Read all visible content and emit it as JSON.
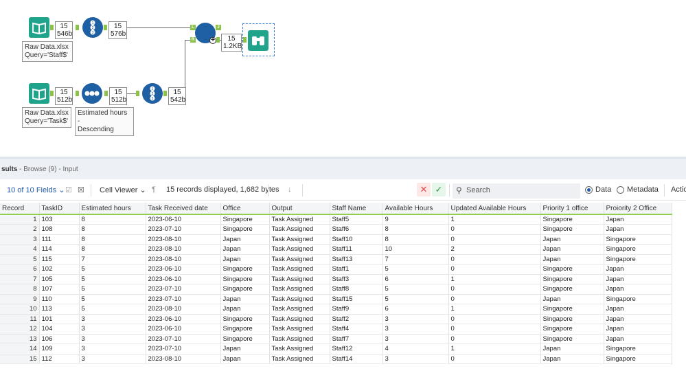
{
  "workflow": {
    "top_input_badge": {
      "count": "15",
      "size": "546b"
    },
    "top_select_badge": {
      "count": "15",
      "size": "576b"
    },
    "join_badge": {
      "count": "15",
      "size": "1.2KB"
    },
    "bottom_input_badge": {
      "count": "15",
      "size": "512b"
    },
    "sort_badge": {
      "count": "15",
      "size": "512b"
    },
    "bottom_select_badge": {
      "count": "15",
      "size": "542b"
    },
    "annot_top": {
      "line1": "Raw Data.xlsx",
      "line2": "Query='Staff$'"
    },
    "annot_bottom": {
      "line1": "Raw Data.xlsx",
      "line2": "Query='Task$'"
    },
    "annot_sort": {
      "line1": "Estimated hours -",
      "line2": "Descending"
    },
    "select_icon": "1 2 3",
    "sort_icon": "•••",
    "join_anchors": {
      "l": "L",
      "r": "R",
      "j": "J"
    }
  },
  "results": {
    "title": "sults",
    "subtitle": " - Browse (9) - Input",
    "fields_label": "10 of 10 Fields",
    "cell_viewer": "Cell Viewer",
    "records_info": "15 records displayed, 1,682 bytes",
    "search_placeholder": "Search",
    "data_label": "Data",
    "metadata_label": "Metadata",
    "actions_label": "Actio",
    "columns": [
      "Record",
      "TaskID",
      "Estimated hours",
      "Task Received date",
      "Office",
      "Output",
      "Staff Name",
      "Available Hours",
      "Updated Available Hours",
      "Priority 1 office",
      "Proiority 2 Office"
    ],
    "rows": [
      [
        "1",
        "103",
        "8",
        "2023-06-10",
        "Singapore",
        "Task Assigned",
        "Staff5",
        "9",
        "1",
        "Singapore",
        "Japan"
      ],
      [
        "2",
        "108",
        "8",
        "2023-07-10",
        "Singapore",
        "Task Assigned",
        "Staff6",
        "8",
        "0",
        "Singapore",
        "Japan"
      ],
      [
        "3",
        "111",
        "8",
        "2023-08-10",
        "Japan",
        "Task Assigned",
        "Staff10",
        "8",
        "0",
        "Japan",
        "Singapore"
      ],
      [
        "4",
        "114",
        "8",
        "2023-08-10",
        "Japan",
        "Task Assigned",
        "Staff11",
        "10",
        "2",
        "Japan",
        "Singapore"
      ],
      [
        "5",
        "115",
        "7",
        "2023-08-10",
        "Japan",
        "Task Assigned",
        "Staff13",
        "7",
        "0",
        "Japan",
        "Singapore"
      ],
      [
        "6",
        "102",
        "5",
        "2023-06-10",
        "Singapore",
        "Task Assigned",
        "Staff1",
        "5",
        "0",
        "Singapore",
        "Japan"
      ],
      [
        "7",
        "105",
        "5",
        "2023-06-10",
        "Singapore",
        "Task Assigned",
        "Staff3",
        "6",
        "1",
        "Singapore",
        "Japan"
      ],
      [
        "8",
        "107",
        "5",
        "2023-07-10",
        "Singapore",
        "Task Assigned",
        "Staff8",
        "5",
        "0",
        "Singapore",
        "Japan"
      ],
      [
        "9",
        "110",
        "5",
        "2023-07-10",
        "Japan",
        "Task Assigned",
        "Staff15",
        "5",
        "0",
        "Japan",
        "Singapore"
      ],
      [
        "10",
        "113",
        "5",
        "2023-08-10",
        "Japan",
        "Task Assigned",
        "Staff9",
        "6",
        "1",
        "Singapore",
        "Japan"
      ],
      [
        "11",
        "101",
        "3",
        "2023-06-10",
        "Singapore",
        "Task Assigned",
        "Staff2",
        "3",
        "0",
        "Singapore",
        "Japan"
      ],
      [
        "12",
        "104",
        "3",
        "2023-06-10",
        "Singapore",
        "Task Assigned",
        "Staff4",
        "3",
        "0",
        "Singapore",
        "Japan"
      ],
      [
        "13",
        "106",
        "3",
        "2023-07-10",
        "Singapore",
        "Task Assigned",
        "Staff7",
        "3",
        "0",
        "Singapore",
        "Japan"
      ],
      [
        "14",
        "109",
        "3",
        "2023-07-10",
        "Japan",
        "Task Assigned",
        "Staff12",
        "4",
        "1",
        "Japan",
        "Singapore"
      ],
      [
        "15",
        "112",
        "3",
        "2023-08-10",
        "Japan",
        "Task Assigned",
        "Staff14",
        "3",
        "0",
        "Japan",
        "Singapore"
      ]
    ]
  },
  "colors": {
    "accent": "#2059a8",
    "tool_green": "#1fa38a",
    "tool_blue": "#1f5fa3",
    "anchor_green": "#8bc34a"
  }
}
